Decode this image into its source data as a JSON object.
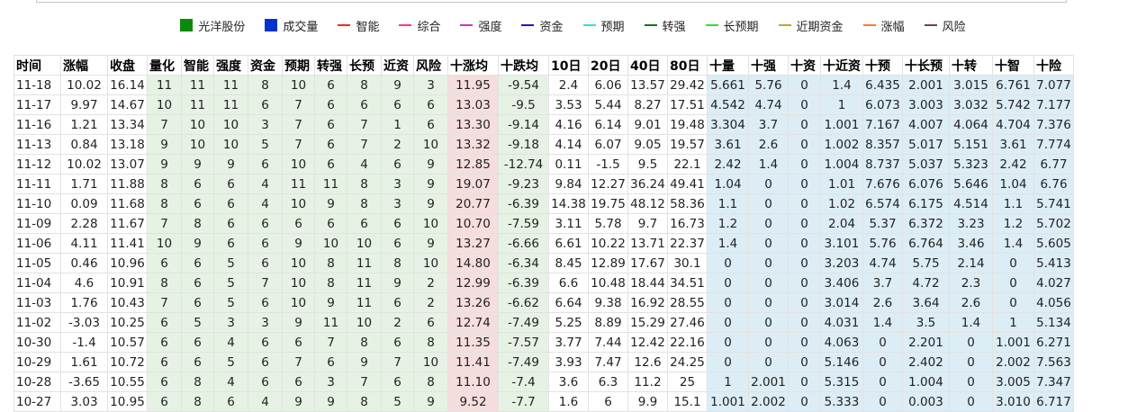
{
  "legend": [
    {
      "label": "光洋股份",
      "color": "#0a8a0a",
      "shape": "box"
    },
    {
      "label": "成交量",
      "color": "#0033cc",
      "shape": "box"
    },
    {
      "label": "智能",
      "color": "#ff2222",
      "shape": "line"
    },
    {
      "label": "综合",
      "color": "#ff3399",
      "shape": "line"
    },
    {
      "label": "强度",
      "color": "#cc33cc",
      "shape": "line"
    },
    {
      "label": "资金",
      "color": "#1a1acc",
      "shape": "line"
    },
    {
      "label": "预期",
      "color": "#33dddd",
      "shape": "line"
    },
    {
      "label": "转强",
      "color": "#117711",
      "shape": "line"
    },
    {
      "label": "长预期",
      "color": "#33dd33",
      "shape": "line"
    },
    {
      "label": "近期资金",
      "color": "#bbaa22",
      "shape": "line"
    },
    {
      "label": "涨幅",
      "color": "#ff7733",
      "shape": "line"
    },
    {
      "label": "风险",
      "color": "#774444",
      "shape": "line"
    }
  ],
  "table": {
    "headers": [
      "时间",
      "涨幅",
      "收盘",
      "量化",
      "智能",
      "强度",
      "资金",
      "预期",
      "转强",
      "长预",
      "近资",
      "风险",
      "十涨均",
      "十跌均",
      "10日",
      "20日",
      "40日",
      "80日",
      "十量",
      "十强",
      "十资",
      "十近资",
      "十预",
      "十长预",
      "十转",
      "十智",
      "十险"
    ],
    "rows": [
      [
        "11-18",
        "10.02",
        "16.14",
        "11",
        "11",
        "11",
        "8",
        "10",
        "6",
        "8",
        "9",
        "3",
        "11.95",
        "-9.54",
        "2.4",
        "6.06",
        "13.57",
        "29.42",
        "5.661",
        "5.76",
        "0",
        "1.4",
        "6.435",
        "2.001",
        "3.015",
        "6.761",
        "7.077"
      ],
      [
        "11-17",
        "9.97",
        "14.67",
        "10",
        "11",
        "11",
        "6",
        "7",
        "6",
        "6",
        "6",
        "6",
        "13.03",
        "-9.5",
        "3.53",
        "5.44",
        "8.27",
        "17.51",
        "4.542",
        "4.74",
        "0",
        "1",
        "6.073",
        "3.003",
        "3.032",
        "5.742",
        "7.177"
      ],
      [
        "11-16",
        "1.21",
        "13.34",
        "7",
        "10",
        "10",
        "3",
        "7",
        "6",
        "7",
        "1",
        "6",
        "13.30",
        "-9.14",
        "4.16",
        "6.14",
        "9.01",
        "19.48",
        "3.304",
        "3.7",
        "0",
        "1.001",
        "7.167",
        "4.007",
        "4.064",
        "4.704",
        "7.376"
      ],
      [
        "11-13",
        "0.84",
        "13.18",
        "9",
        "10",
        "10",
        "5",
        "7",
        "6",
        "7",
        "2",
        "10",
        "13.32",
        "-9.18",
        "4.14",
        "6.07",
        "9.05",
        "19.57",
        "3.61",
        "2.6",
        "0",
        "1.002",
        "8.357",
        "5.017",
        "5.151",
        "3.61",
        "7.774"
      ],
      [
        "11-12",
        "10.02",
        "13.07",
        "9",
        "9",
        "9",
        "6",
        "10",
        "6",
        "4",
        "6",
        "9",
        "12.85",
        "-12.74",
        "0.11",
        "-1.5",
        "9.5",
        "22.1",
        "2.42",
        "1.4",
        "0",
        "1.004",
        "8.737",
        "5.037",
        "5.323",
        "2.42",
        "6.77"
      ],
      [
        "11-11",
        "1.71",
        "11.88",
        "8",
        "6",
        "6",
        "4",
        "11",
        "11",
        "8",
        "3",
        "9",
        "19.07",
        "-9.23",
        "9.84",
        "12.27",
        "36.24",
        "49.41",
        "1.04",
        "0",
        "0",
        "1.01",
        "7.676",
        "6.076",
        "5.646",
        "1.04",
        "6.76"
      ],
      [
        "11-10",
        "0.09",
        "11.68",
        "8",
        "6",
        "6",
        "4",
        "10",
        "9",
        "8",
        "3",
        "9",
        "20.77",
        "-6.39",
        "14.38",
        "19.75",
        "48.12",
        "58.36",
        "1.1",
        "0",
        "0",
        "1.02",
        "6.574",
        "6.175",
        "4.514",
        "1.1",
        "5.741"
      ],
      [
        "11-09",
        "2.28",
        "11.67",
        "7",
        "8",
        "6",
        "6",
        "6",
        "6",
        "6",
        "6",
        "10",
        "10.70",
        "-7.59",
        "3.11",
        "5.78",
        "9.7",
        "16.73",
        "1.2",
        "0",
        "0",
        "2.04",
        "5.37",
        "6.372",
        "3.23",
        "1.2",
        "5.702"
      ],
      [
        "11-06",
        "4.11",
        "11.41",
        "10",
        "9",
        "6",
        "6",
        "9",
        "10",
        "10",
        "6",
        "9",
        "13.27",
        "-6.66",
        "6.61",
        "10.22",
        "13.71",
        "22.37",
        "1.4",
        "0",
        "0",
        "3.101",
        "5.76",
        "6.764",
        "3.46",
        "1.4",
        "5.605"
      ],
      [
        "11-05",
        "0.46",
        "10.96",
        "6",
        "6",
        "5",
        "6",
        "10",
        "8",
        "11",
        "8",
        "10",
        "14.80",
        "-6.34",
        "8.45",
        "12.89",
        "17.67",
        "30.1",
        "0",
        "0",
        "0",
        "3.203",
        "4.74",
        "5.75",
        "2.14",
        "0",
        "5.413"
      ],
      [
        "11-04",
        "4.6",
        "10.91",
        "8",
        "6",
        "5",
        "7",
        "10",
        "8",
        "11",
        "9",
        "2",
        "12.99",
        "-6.39",
        "6.6",
        "10.48",
        "18.44",
        "34.51",
        "0",
        "0",
        "0",
        "3.406",
        "3.7",
        "4.72",
        "2.3",
        "0",
        "4.027"
      ],
      [
        "11-03",
        "1.76",
        "10.43",
        "7",
        "6",
        "5",
        "6",
        "10",
        "9",
        "11",
        "6",
        "2",
        "13.26",
        "-6.62",
        "6.64",
        "9.38",
        "16.92",
        "28.55",
        "0",
        "0",
        "0",
        "3.014",
        "2.6",
        "3.64",
        "2.6",
        "0",
        "4.056"
      ],
      [
        "11-02",
        "-3.03",
        "10.25",
        "6",
        "5",
        "3",
        "3",
        "9",
        "11",
        "10",
        "2",
        "6",
        "12.74",
        "-7.49",
        "5.25",
        "8.89",
        "15.29",
        "27.46",
        "0",
        "0",
        "0",
        "4.031",
        "1.4",
        "3.5",
        "1.4",
        "1",
        "5.134"
      ],
      [
        "10-30",
        "-1.4",
        "10.57",
        "6",
        "6",
        "4",
        "6",
        "6",
        "7",
        "8",
        "6",
        "8",
        "11.35",
        "-7.57",
        "3.77",
        "7.44",
        "12.42",
        "22.16",
        "0",
        "0",
        "0",
        "4.063",
        "0",
        "2.201",
        "0",
        "1.001",
        "6.271"
      ],
      [
        "10-29",
        "1.61",
        "10.72",
        "6",
        "6",
        "5",
        "6",
        "7",
        "6",
        "9",
        "7",
        "10",
        "11.41",
        "-7.49",
        "3.93",
        "7.47",
        "12.6",
        "24.25",
        "0",
        "0",
        "0",
        "5.146",
        "0",
        "2.402",
        "0",
        "2.002",
        "7.563"
      ],
      [
        "10-28",
        "-3.65",
        "10.55",
        "6",
        "8",
        "4",
        "6",
        "6",
        "3",
        "7",
        "6",
        "8",
        "11.10",
        "-7.4",
        "3.6",
        "6.3",
        "11.2",
        "25",
        "1",
        "2.001",
        "0",
        "5.315",
        "0",
        "1.004",
        "0",
        "3.005",
        "7.347"
      ],
      [
        "10-27",
        "3.03",
        "10.95",
        "6",
        "8",
        "6",
        "4",
        "9",
        "9",
        "8",
        "5",
        "9",
        "9.52",
        "-7.7",
        "1.6",
        "6",
        "9.9",
        "15.1",
        "1.001",
        "2.002",
        "0",
        "5.333",
        "0",
        "0.003",
        "0",
        "3.010",
        "6.717"
      ]
    ]
  },
  "colors": {
    "up": "#e00000",
    "down": "#009000",
    "green_bg": "#e6f3e4",
    "pink_bg": "#f6dede",
    "blue_bg": "#dcedf5"
  }
}
